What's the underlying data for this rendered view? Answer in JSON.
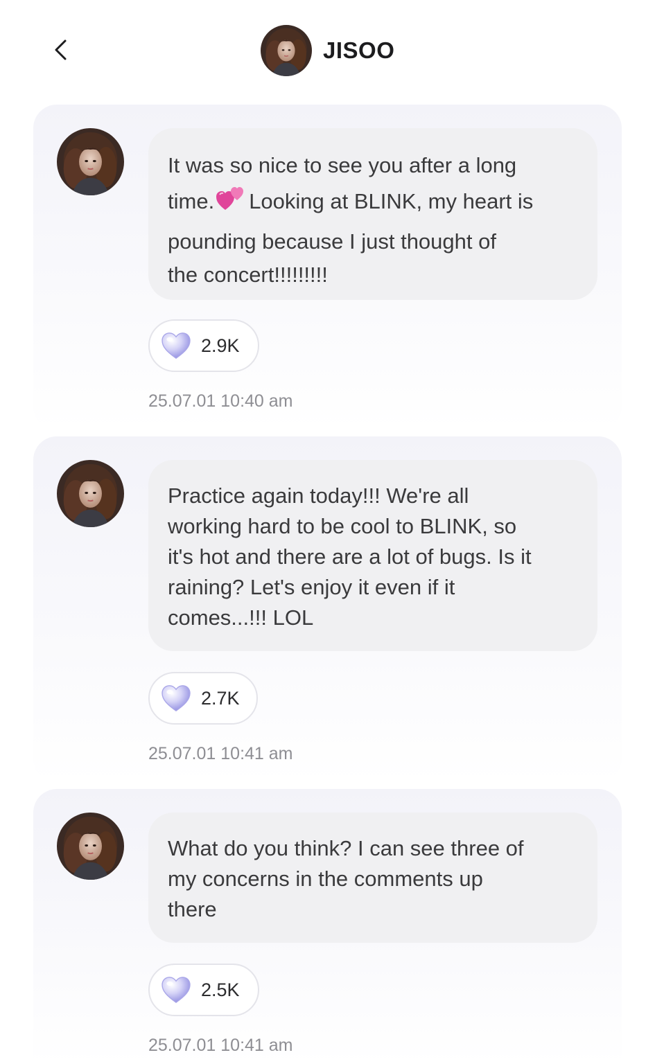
{
  "header": {
    "title": "JISOO",
    "back_icon": "chevron-left-icon"
  },
  "posts": [
    {
      "lines": [
        "It was so nice to see you after a long",
        "time.",
        "Looking at BLINK, my heart is",
        "pounding because I just thought of",
        "the concert!!!!!!!!!"
      ],
      "emoji": "two-hearts-emoji",
      "likes": "2.9K",
      "timestamp": "25.07.01 10:40 am"
    },
    {
      "lines": [
        "Practice again today!!! We're all",
        "working hard to be cool to BLINK, so",
        "it's hot and there are a lot of bugs. Is it",
        "raining? Let's enjoy it even if it",
        "comes...!!! LOL"
      ],
      "likes": "2.7K",
      "timestamp": "25.07.01 10:41 am"
    },
    {
      "lines": [
        "What do you think? I can see three of",
        "my concerns in the comments up",
        "there"
      ],
      "likes": "2.5K",
      "timestamp": "25.07.01 10:41 am"
    }
  ],
  "colors": {
    "bubble": "#f0f0f2",
    "card_top": "#f3f3f9",
    "heart": "#b9b7f0",
    "timestamp": "#8e8e93"
  }
}
